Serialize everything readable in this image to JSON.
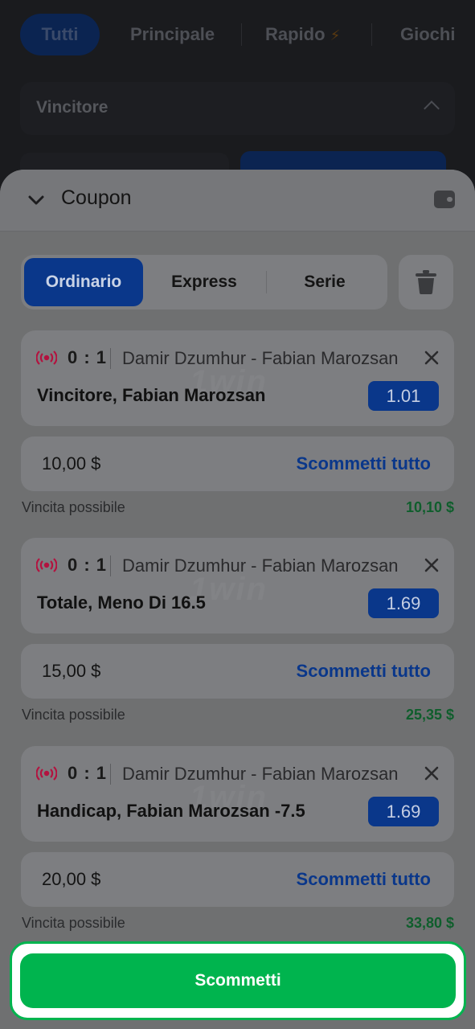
{
  "background": {
    "tabs": [
      "Tutti",
      "Principale",
      "Rapido",
      "Giochi"
    ],
    "market_title": "Vincitore"
  },
  "coupon": {
    "title": "Coupon",
    "tabs": {
      "ordinario": "Ordinario",
      "express": "Express",
      "serie": "Serie"
    },
    "bets": [
      {
        "score": "0 : 1",
        "match": "Damir Dzumhur - Fabian Marozsan",
        "selection": "Vincitore, Fabian Marozsan",
        "odd": "1.01",
        "stake": "10,00 $",
        "bet_all": "Scommetti tutto",
        "win_label": "Vincita possibile",
        "win_value": "10,10 $"
      },
      {
        "score": "0 : 1",
        "match": "Damir Dzumhur - Fabian Marozsan",
        "selection": "Totale, Meno Di 16.5",
        "odd": "1.69",
        "stake": "15,00 $",
        "bet_all": "Scommetti tutto",
        "win_label": "Vincita possibile",
        "win_value": "25,35 $"
      },
      {
        "score": "0 : 1",
        "match": "Damir Dzumhur - Fabian Marozsan",
        "selection": "Handicap, Fabian Marozsan -7.5",
        "odd": "1.69",
        "stake": "20,00 $",
        "bet_all": "Scommetti tutto",
        "win_label": "Vincita possibile",
        "win_value": "33,80 $"
      }
    ],
    "submit_label": "Scommetti"
  },
  "colors": {
    "accent_blue": "#0a378a",
    "cta_green": "#00b44e",
    "live_red": "#b3123f"
  },
  "icons": [
    "chevron-down-icon",
    "wallet-icon",
    "trash-icon",
    "live-broadcast-icon",
    "close-icon"
  ]
}
